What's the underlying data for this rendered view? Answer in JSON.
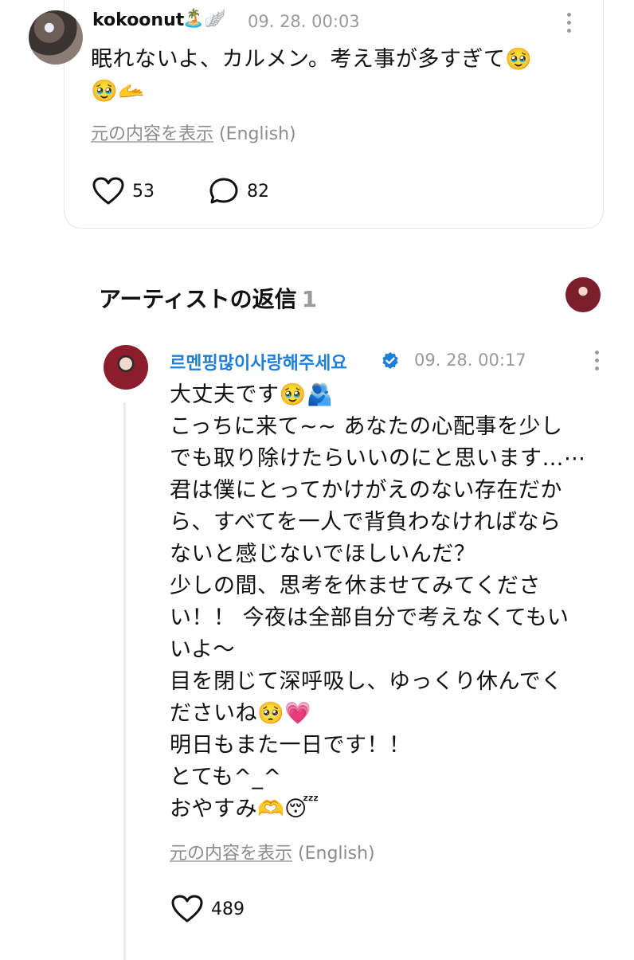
{
  "user_post": {
    "username": "kokoonut",
    "badges": "🏝️🪽",
    "timestamp": "09. 28. 00:03",
    "body": "眠れないよ、カルメン。考え事が多すぎて🥹\n🥹🫴",
    "translate_link": "元の内容を表示",
    "translate_lang": "(English)",
    "likes": "53",
    "comments": "82"
  },
  "section": {
    "title": "アーティストの返信",
    "count": "1"
  },
  "artist_reply": {
    "name": "르멘핑많이사랑해주세요",
    "timestamp": "09. 28. 00:17",
    "body": "大丈夫です🥹🫂\nこっちに来て~~ あなたの心配事を少し\nでも取り除けたらいいのにと思います…⋯\n君は僕にとってかけがえのない存在だか\nら、すべてを一人で背負わなければなら\nないと感じないでほしいんだ？\n少しの間、思考を休ませてみてくださ\nい！！ 今夜は全部自分で考えなくてもい\nいよ～\n目を閉じて深呼吸し、ゆっくり休んでく\nださいね🥺💗\n明日もまた一日です！！\nとても^_^\nおやすみ🫶😴",
    "translate_link": "元の内容を表示",
    "translate_lang": "(English)",
    "likes": "489"
  },
  "colors": {
    "artist_name": "#1e7fd8",
    "verified_badge": "#1e7fd8",
    "muted_text": "#9a9a9a"
  },
  "icons": [
    "heart-icon",
    "comment-icon",
    "kebab-menu-icon",
    "verified-badge-icon"
  ]
}
